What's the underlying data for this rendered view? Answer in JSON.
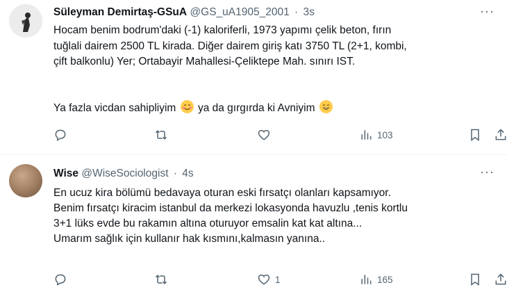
{
  "tweets": [
    {
      "name": "Süleyman Demirtaş-GSuA",
      "handle": "@GS_uA1905_2001",
      "time": "3s",
      "text_lines": [
        "Hocam benim bodrum'daki (-1) kaloriferli, 1973 yapımı çelik beton, fırın",
        "tuğlali dairem 2500 TL kirada. Diğer dairem giriş katı 3750 TL (2+1, kombi,",
        "çift balkonlu) Yer; Ortabayir Mahallesi-Çeliktepe Mah. sınırı IST."
      ],
      "line2_part1": "Ya fazla vicdan sahipliyim",
      "line2_part2": "ya da gırgırda ki Avniyim",
      "emojis": [
        "smiling-face-icon",
        "grinning-face-icon"
      ],
      "likes": "",
      "views": "103"
    },
    {
      "name": "Wise",
      "handle": "@WiseSociologist",
      "time": "4s",
      "text_lines": [
        "En ucuz kira bölümü bedavaya oturan eski fırsatçı olanları kapsamıyor.",
        "Benim fırsatçı kiracim istanbul da merkezi lokasyonda havuzlu ,tenis kortlu",
        "3+1 lüks evde bu rakamın altına oturuyor emsalin kat kat altına...",
        "Umarım sağlık için kullanır hak kısmını,kalmasın yanına.."
      ],
      "likes": "1",
      "views": "165"
    }
  ],
  "more_label": "···",
  "separator": "·"
}
